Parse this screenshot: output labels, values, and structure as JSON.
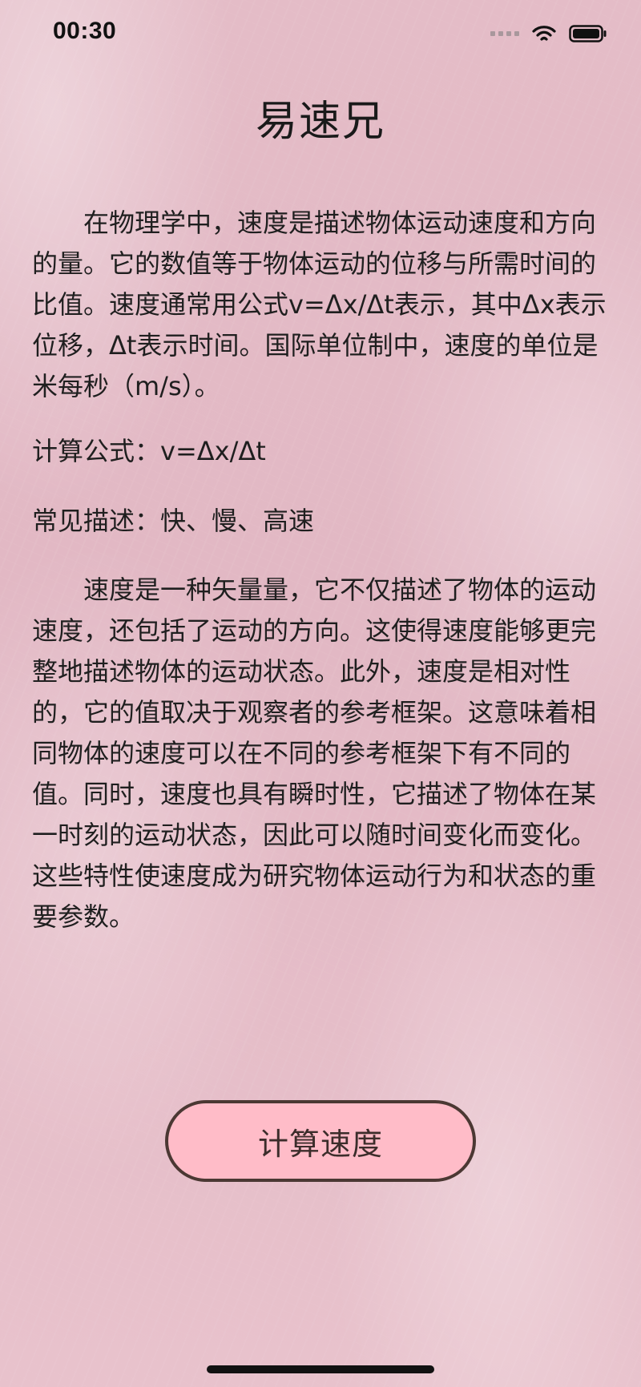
{
  "status_bar": {
    "time": "00:30",
    "icons": [
      "signal-icon",
      "wifi-icon",
      "battery-icon"
    ]
  },
  "page": {
    "title": "易速兄"
  },
  "content": {
    "intro": "在物理学中，速度是描述物体运动速度和方向的量。它的数值等于物体运动的位移与所需时间的比值。速度通常用公式v=Δx/Δt表示，其中Δx表示位移，Δt表示时间。国际单位制中，速度的单位是米每秒（m/s）。",
    "formula_line": "计算公式：v=Δx/Δt",
    "description_line": "常见描述：快、慢、高速",
    "detail": "速度是一种矢量量，它不仅描述了物体的运动速度，还包括了运动的方向。这使得速度能够更完整地描述物体的运动状态。此外，速度是相对性的，它的值取决于观察者的参考框架。这意味着相同物体的速度可以在不同的参考框架下有不同的值。同时，速度也具有瞬时性，它描述了物体在某一时刻的运动状态，因此可以随时间变化而变化。这些特性使速度成为研究物体运动行为和状态的重要参数。"
  },
  "action": {
    "button_label": "计算速度"
  },
  "colors": {
    "background": "#e4bcc7",
    "button_fill": "#ffbcc8",
    "button_border": "#4b3833",
    "text": "#1f1f1f"
  }
}
